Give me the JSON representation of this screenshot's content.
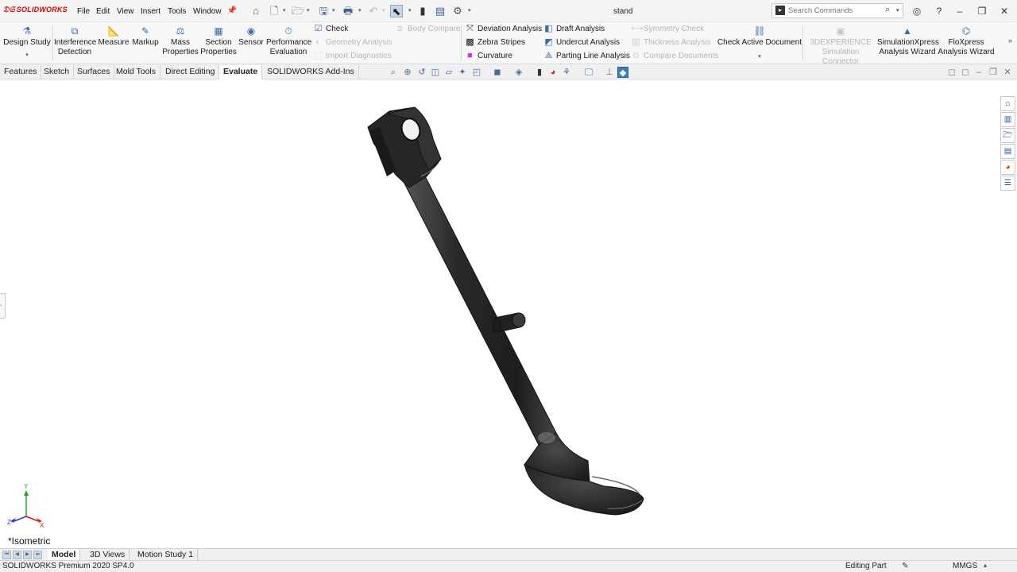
{
  "app": {
    "logo_text": "SOLIDWORKS",
    "document_title": "stand"
  },
  "menu": [
    "File",
    "Edit",
    "View",
    "Insert",
    "Tools",
    "Window"
  ],
  "search": {
    "placeholder": "Search Commands"
  },
  "commands": {
    "design_study": "Design Study",
    "interference_detection": "Interference Detection",
    "measure": "Measure",
    "markup": "Markup",
    "mass_properties": "Mass Properties",
    "section_properties": "Section Properties",
    "sensor": "Sensor",
    "performance_evaluation": "Performance Evaluation",
    "check": "Check",
    "geometry_analysis": "Geometry Analysis",
    "import_diagnostics": "Import Diagnostics",
    "body_compare": "Body Compare",
    "deviation_analysis": "Deviation Analysis",
    "zebra_stripes": "Zebra Stripes",
    "curvature": "Curvature",
    "draft_analysis": "Draft Analysis",
    "undercut_analysis": "Undercut Analysis",
    "parting_line_analysis": "Parting Line Analysis",
    "symmetry_check": "Symmetry Check",
    "thickness_analysis": "Thickness Analysis",
    "compare_documents": "Compare Documents",
    "check_active_document": "Check Active Document",
    "experience_connector": "3DEXPERIENCE Simulation Connector",
    "simulationxpress": "SimulationXpress Analysis Wizard",
    "floxpress": "FloXpress Analysis Wizard"
  },
  "cm_tabs": [
    "Features",
    "Sketch",
    "Surfaces",
    "Mold Tools",
    "Direct Editing",
    "Evaluate",
    "SOLIDWORKS Add-Ins"
  ],
  "active_cm_tab": "Evaluate",
  "viewport": {
    "view_label": "*Isometric",
    "triad": {
      "x": "X",
      "y": "Y",
      "z": "Z"
    }
  },
  "bottom_tabs": [
    "Model",
    "3D Views",
    "Motion Study 1"
  ],
  "status": {
    "version": "SOLIDWORKS Premium 2020 SP4.0",
    "mode": "Editing Part",
    "units": "MMGS"
  },
  "colors": {
    "brand_red": "#d40000",
    "part": "#2b2b2b",
    "accent_blue": "#3a6ea8"
  }
}
